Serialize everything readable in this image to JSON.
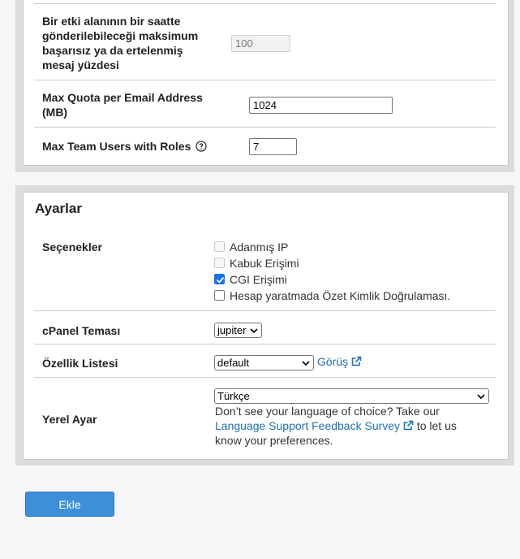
{
  "limits": {
    "fail_percent_label": "Bir etki alanının bir saatte gönderilebileceği maksimum başarısız ya da ertelenmiş mesaj yüzdesi",
    "fail_percent_placeholder": "100",
    "quota_label": "Max Quota per Email Address (MB)",
    "quota_value": "1024",
    "team_users_label": "Max Team Users with Roles",
    "team_users_value": "7"
  },
  "settings": {
    "title": "Ayarlar",
    "options_label": "Seçenekler",
    "options": [
      {
        "label": "Adanmış IP",
        "checked": false,
        "disabled": true
      },
      {
        "label": "Kabuk Erişimi",
        "checked": false,
        "disabled": true
      },
      {
        "label": "CGI Erişimi",
        "checked": true,
        "disabled": false
      },
      {
        "label": "Hesap yaratmada Özet Kimlik Doğrulaması.",
        "checked": false,
        "disabled": false
      }
    ],
    "theme_label": "cPanel Teması",
    "theme_value": "jupiter",
    "feature_label": "Özellik Listesi",
    "feature_value": "default",
    "feature_view_link": "Görüş",
    "locale_label": "Yerel Ayar",
    "locale_value": "Türkçe",
    "locale_help_1": "Don’t see your language of choice? Take our",
    "locale_help_link": "Language Support Feedback Survey",
    "locale_help_2": "to let us",
    "locale_help_3": "know your preferences."
  },
  "submit_label": "Ekle",
  "colors": {
    "primary_button": "#3d8fd9",
    "link": "#1f6fb5",
    "checkbox_checked": "#1a73e8"
  },
  "icons": [
    "help-circle-icon",
    "external-link-icon",
    "chevron-down-icon",
    "checkmark-icon"
  ]
}
